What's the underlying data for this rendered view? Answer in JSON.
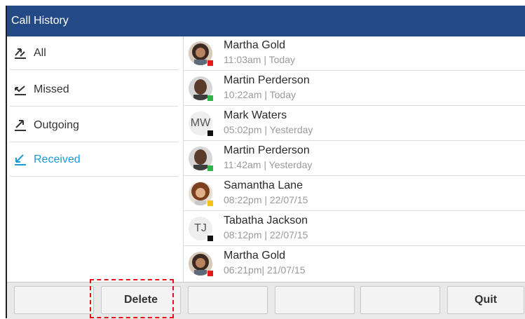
{
  "header": {
    "title": "Call History"
  },
  "sidebar": {
    "items": [
      {
        "label": "All",
        "icon": "all-calls-icon",
        "active": false
      },
      {
        "label": "Missed",
        "icon": "missed-call-icon",
        "active": false
      },
      {
        "label": "Outgoing",
        "icon": "outgoing-call-icon",
        "active": false
      },
      {
        "label": "Received",
        "icon": "received-call-icon",
        "active": true
      }
    ]
  },
  "calls": [
    {
      "name": "Martha Gold",
      "time": "11:03am | Today",
      "avatar": "photo",
      "status_color": "#e31b1b"
    },
    {
      "name": "Martin Perderson",
      "time": "10:22am | Today",
      "avatar": "photo",
      "status_color": "#2fb34a"
    },
    {
      "name": "Mark Waters",
      "time": "05:02pm | Yesterday",
      "avatar": "initials",
      "initials": "MW",
      "status_color": "#111111"
    },
    {
      "name": "Martin Perderson",
      "time": "11:42am | Yesterday",
      "avatar": "photo",
      "status_color": "#2fb34a"
    },
    {
      "name": "Samantha Lane",
      "time": "08:22pm | 22/07/15",
      "avatar": "photo",
      "status_color": "#f2c21b"
    },
    {
      "name": "Tabatha Jackson",
      "time": "08:12pm | 22/07/15",
      "avatar": "initials",
      "initials": "TJ",
      "status_color": "#111111"
    },
    {
      "name": "Martha Gold",
      "time": "06:21pm| 21/07/15",
      "avatar": "photo",
      "status_color": "#e31b1b"
    }
  ],
  "softkeys": {
    "key1": "",
    "delete": "Delete",
    "key3": "",
    "key4": "",
    "key5": "",
    "quit": "Quit"
  },
  "colors": {
    "titlebar": "#244a86",
    "active": "#1a9cd8",
    "highlight": "#e3141a"
  }
}
